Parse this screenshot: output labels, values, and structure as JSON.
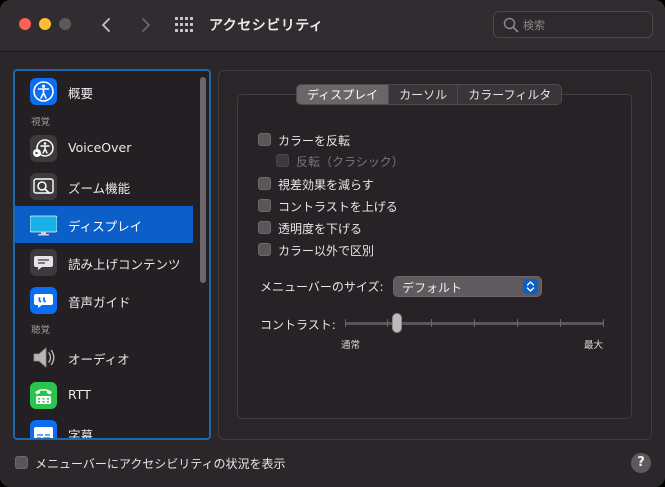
{
  "window": {
    "title": "アクセシビリティ"
  },
  "search": {
    "placeholder": "検索"
  },
  "sidebar": {
    "items": [
      {
        "label": "概要",
        "icon": "accessibility-icon"
      },
      {
        "label": "VoiceOver",
        "icon": "voiceover-icon"
      },
      {
        "label": "ズーム機能",
        "icon": "zoom-icon"
      },
      {
        "label": "ディスプレイ",
        "icon": "display-icon",
        "selected": true
      },
      {
        "label": "読み上げコンテンツ",
        "icon": "spoken-content-icon"
      },
      {
        "label": "音声ガイド",
        "icon": "descriptions-icon"
      },
      {
        "label": "オーディオ",
        "icon": "speaker-icon"
      },
      {
        "label": "RTT",
        "icon": "rtt-icon"
      },
      {
        "label": "字幕",
        "icon": "captions-icon"
      }
    ],
    "sections": {
      "vision": "視覚",
      "hearing": "聴覚"
    }
  },
  "tabs": [
    {
      "label": "ディスプレイ",
      "active": true
    },
    {
      "label": "カーソル",
      "active": false
    },
    {
      "label": "カラーフィルタ",
      "active": false
    }
  ],
  "display": {
    "options": [
      {
        "label": "カラーを反転",
        "checked": false,
        "enabled": true
      },
      {
        "label": "反転（クラシック）",
        "checked": false,
        "enabled": false
      },
      {
        "label": "視差効果を減らす",
        "checked": false,
        "enabled": true
      },
      {
        "label": "コントラストを上げる",
        "checked": false,
        "enabled": true
      },
      {
        "label": "透明度を下げる",
        "checked": false,
        "enabled": true
      },
      {
        "label": "カラー以外で区別",
        "checked": false,
        "enabled": true
      }
    ],
    "menubar_size_label": "メニューバーのサイズ:",
    "menubar_size_value": "デフォルト",
    "contrast_label": "コントラスト:",
    "contrast_min": "通常",
    "contrast_max": "最大",
    "contrast_level": 0.2
  },
  "footer": {
    "show_status_label": "メニューバーにアクセシビリティの状況を表示",
    "show_status_checked": false
  },
  "colors": {
    "accent": "#0c5fc8",
    "sidebar_focus": "#1d68ae",
    "close": "#fe5f57",
    "minimize": "#febc2e"
  }
}
